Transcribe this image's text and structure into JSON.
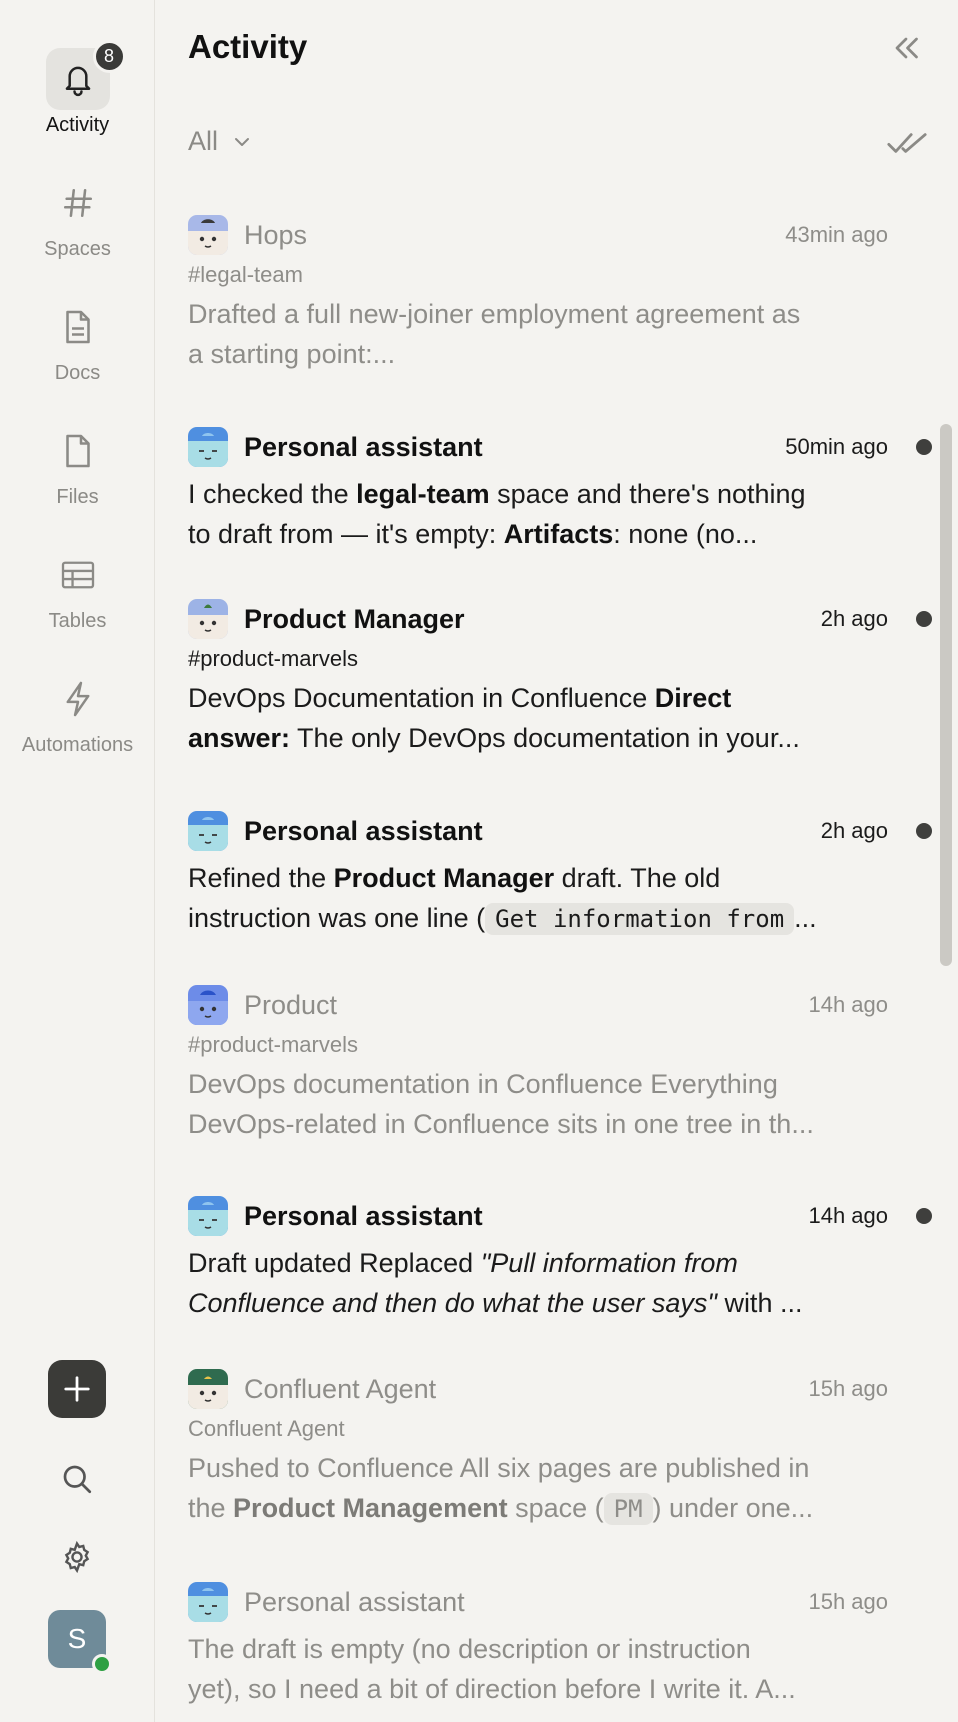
{
  "nav": {
    "activity": {
      "label": "Activity",
      "badge": "8"
    },
    "spaces": {
      "label": "Spaces"
    },
    "docs": {
      "label": "Docs"
    },
    "files": {
      "label": "Files"
    },
    "tables": {
      "label": "Tables"
    },
    "automations": {
      "label": "Automations"
    }
  },
  "user": {
    "initial": "S",
    "status": "online"
  },
  "header": {
    "title": "Activity"
  },
  "filter": {
    "label": "All"
  },
  "colors": {
    "accent": "#3b3b38",
    "online": "#2ea043",
    "background": "#f4f3f0"
  },
  "feed": [
    {
      "sender": "Hops",
      "time": "43min ago",
      "channel": "#legal-team",
      "unread": false,
      "line1": {
        "t1": "Drafted a full new-joiner employment agreement as"
      },
      "line2": {
        "t1": "a starting point:..."
      }
    },
    {
      "sender": "Personal assistant",
      "time": "50min ago",
      "unread": true,
      "line1": {
        "t1": "I checked the ",
        "b1": "legal-team",
        "t2": " space and there's nothing"
      },
      "line2": {
        "t1": "to draft from — it's empty: ",
        "b1": "Artifacts",
        "t2": ": none (no..."
      }
    },
    {
      "sender": "Product Manager",
      "time": "2h ago",
      "channel": "#product-marvels",
      "unread": true,
      "line1": {
        "t1": "DevOps Documentation in Confluence ",
        "b1": "Direct"
      },
      "line2": {
        "b1": "answer:",
        "t1": " The only DevOps documentation in your..."
      }
    },
    {
      "sender": "Personal assistant",
      "time": "2h ago",
      "unread": true,
      "line1": {
        "t1": "Refined the ",
        "b1": "Product Manager",
        "t2": " draft. The old"
      },
      "line2": {
        "t1": "instruction was one line (",
        "code": "Get information from",
        "t2": "..."
      }
    },
    {
      "sender": "Product",
      "time": "14h ago",
      "channel": "#product-marvels",
      "unread": false,
      "line1": {
        "t1": "DevOps documentation in Confluence Everything"
      },
      "line2": {
        "t1": "DevOps-related in Confluence sits in one tree in th..."
      }
    },
    {
      "sender": "Personal assistant",
      "time": "14h ago",
      "unread": true,
      "line1": {
        "t1": "Draft updated Replaced ",
        "i1": "\"Pull information from"
      },
      "line2": {
        "i1": "Confluence and then do what the user says\"",
        "t1": " with ..."
      }
    },
    {
      "sender": "Confluent Agent",
      "time": "15h ago",
      "channel": "Confluent Agent",
      "unread": false,
      "line1": {
        "t1": "Pushed to Confluence All six pages are published in"
      },
      "line2": {
        "t1": "the ",
        "b1": "Product Management",
        "t2": " space (",
        "code": "PM",
        "t3": ") under one..."
      }
    },
    {
      "sender": "Personal assistant",
      "time": "15h ago",
      "unread": false,
      "line1": {
        "t1": "The draft is empty (no description or instruction"
      },
      "line2": {
        "t1": "yet), so I need a bit of direction before I write it. A..."
      }
    }
  ]
}
